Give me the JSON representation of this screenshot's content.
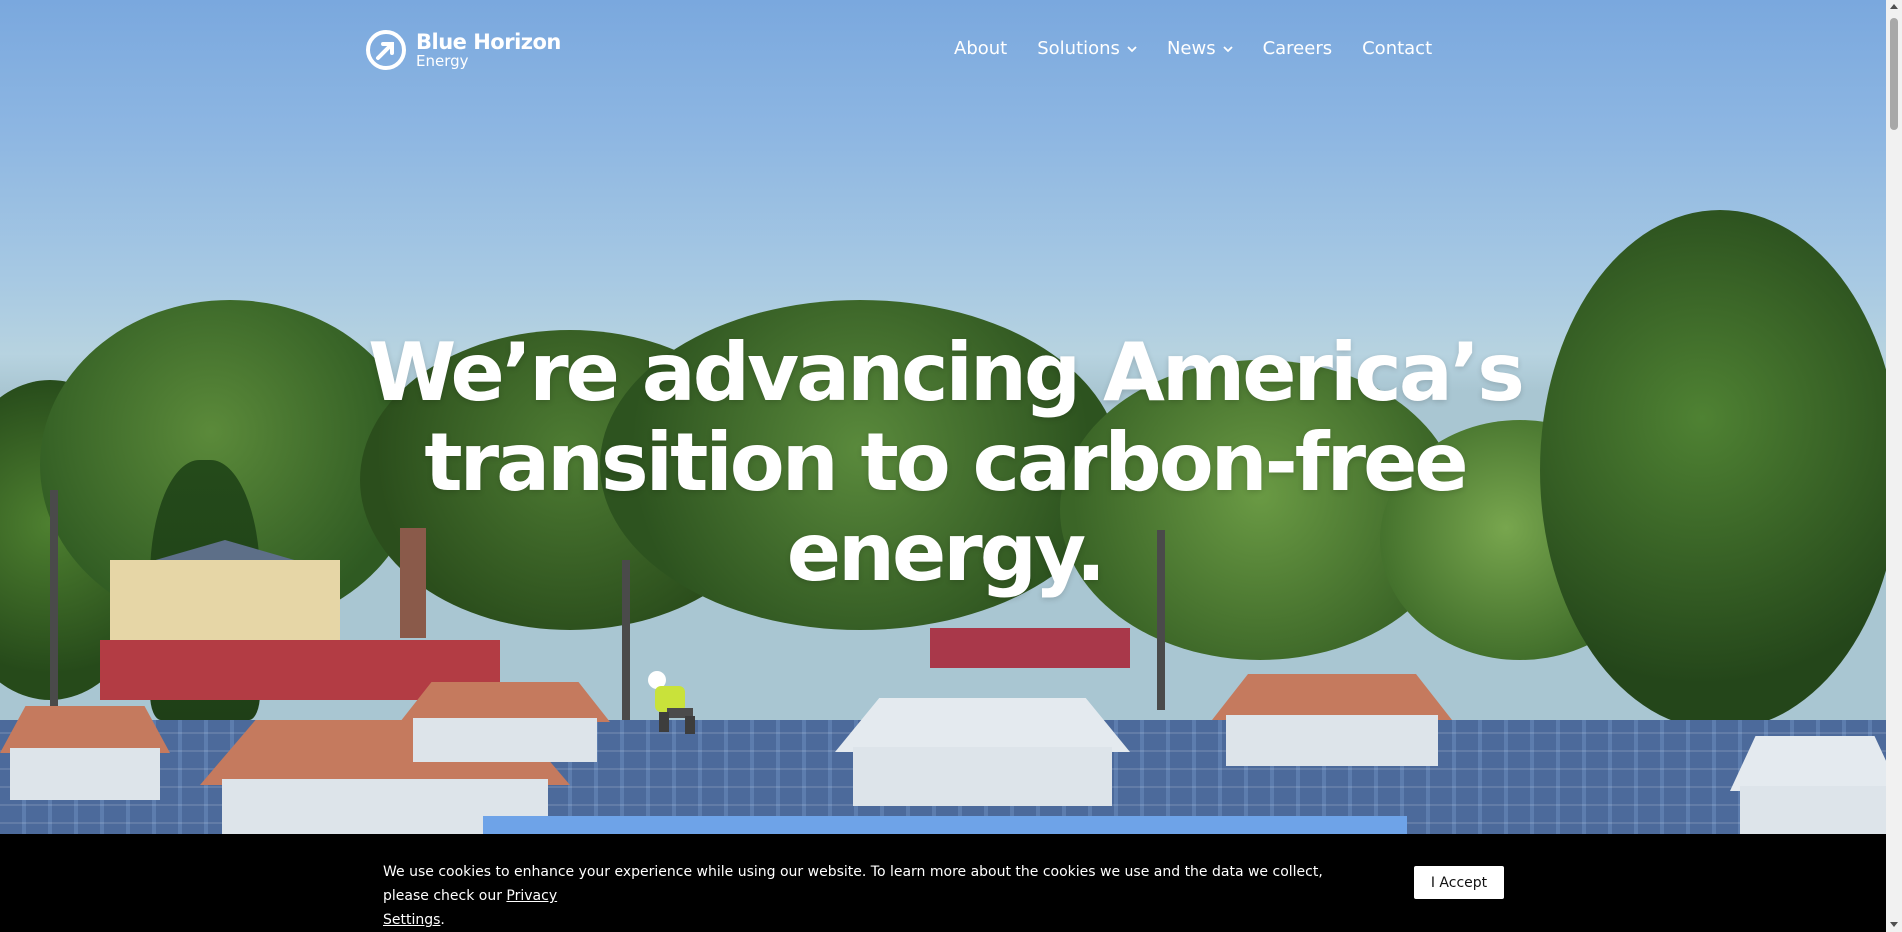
{
  "brand": {
    "name": "Blue Horizon",
    "sub": "Energy",
    "icon": "arrow-circle-logo-icon"
  },
  "nav": [
    {
      "label": "About",
      "dropdown": false
    },
    {
      "label": "Solutions",
      "dropdown": true
    },
    {
      "label": "News",
      "dropdown": true
    },
    {
      "label": "Careers",
      "dropdown": false
    },
    {
      "label": "Contact",
      "dropdown": false
    }
  ],
  "hero": {
    "line1": "We’re advancing America’s",
    "line2": "transition to carbon-free",
    "line3": "energy."
  },
  "cookie": {
    "text": "We use cookies to enhance your experience while using our website. To learn more about the cookies we use and the data we collect, please check our ",
    "link_part1": "Privacy",
    "link_part2": "Settings",
    "end": ".",
    "accept_label": "I Accept"
  },
  "colors": {
    "cookie_bg": "#000000",
    "nav_text": "#ffffff",
    "accent_strip": "#6ea3e8"
  }
}
